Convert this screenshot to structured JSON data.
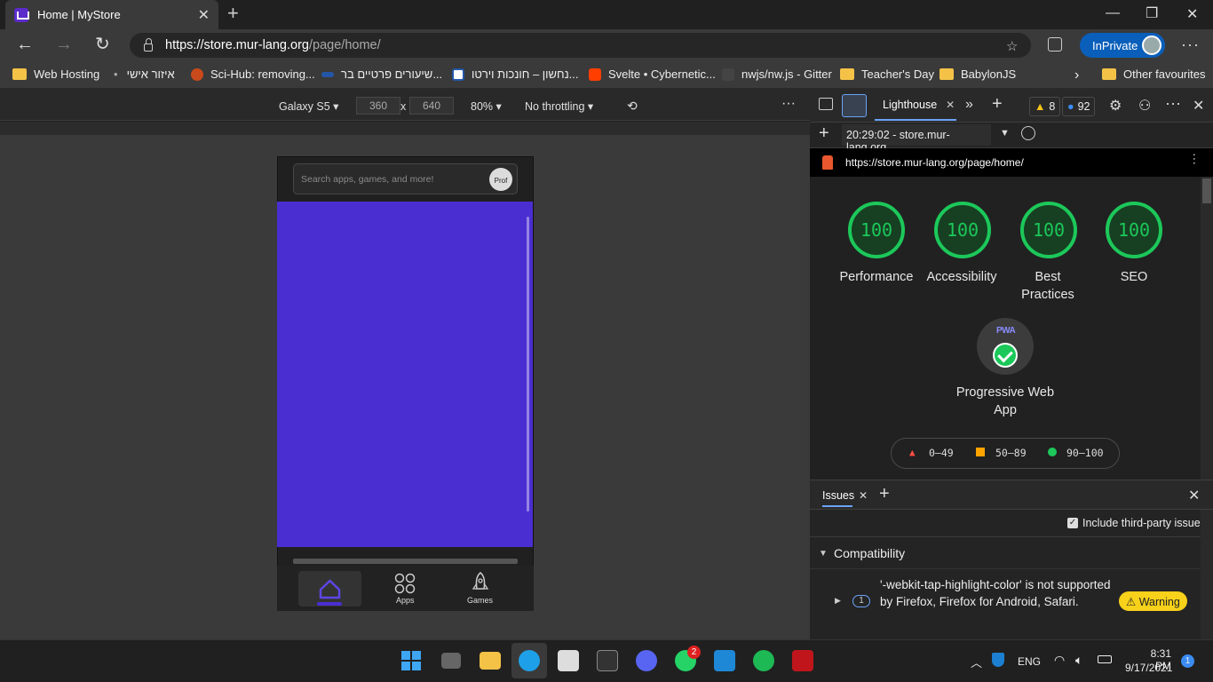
{
  "browser": {
    "tab_title": "Home | MyStore",
    "url_host": "https://store.mur-lang.org",
    "url_path": "/page/home/",
    "inprivate_label": "InPrivate",
    "bookmarks": [
      "Web Hosting",
      "איזור אישי",
      "Sci-Hub: removing...",
      "שיעורים פרטיים בר...",
      "נחשון – חונכות וירטו...",
      "Svelte • Cybernetic...",
      "nwjs/nw.js - Gitter",
      "Teacher's Day",
      "BabylonJS"
    ],
    "other_favourites": "Other favourites"
  },
  "device_toolbar": {
    "device": "Galaxy S5",
    "width": "360",
    "times": "x",
    "height": "640",
    "zoom": "80%",
    "throttling": "No throttling"
  },
  "app": {
    "search_placeholder": "Search apps, games, and more!",
    "profile_alt": "Prof",
    "nav": [
      "Apps",
      "Games"
    ]
  },
  "devtools": {
    "active_tab": "Lighthouse",
    "warnings_count": "8",
    "issues_count": "92",
    "report_select": "20:29:02 - store.mur-lang.org",
    "report_url": "https://store.mur-lang.org/page/home/",
    "scores": [
      {
        "value": "100",
        "label": "Performance"
      },
      {
        "value": "100",
        "label": "Accessibility"
      },
      {
        "value": "100",
        "label": "Best Practices"
      },
      {
        "value": "100",
        "label": "SEO"
      }
    ],
    "pwa_badge": "PWA",
    "pwa_label": "Progressive Web App",
    "legend": [
      "0–49",
      "50–89",
      "90–100"
    ],
    "colors": {
      "pass": "#1cc85a",
      "average": "#ffa400",
      "fail": "#ff4e42",
      "accent": "#6aa3f7"
    }
  },
  "issues": {
    "tab": "Issues",
    "third_party_label": "Include third-party issues",
    "section": "Compatibility",
    "item_count": "1",
    "item_text": "'-webkit-tap-highlight-color' is not supported by Firefox, Firefox for Android, Safari.",
    "badge": "Warning"
  },
  "taskbar": {
    "lang": "ENG",
    "time": "8:31 PM",
    "date": "9/17/2021",
    "whatsapp_badge": "2",
    "notif_count": "1"
  }
}
